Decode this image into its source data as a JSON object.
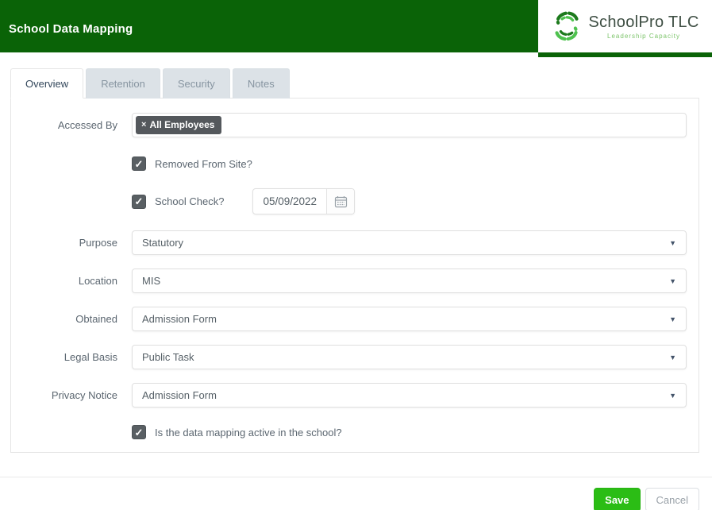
{
  "header": {
    "title": "School Data Mapping",
    "logo": {
      "name": "SchoolPro TLC",
      "tagline": "Leadership Capacity"
    }
  },
  "tabs": [
    {
      "label": "Overview",
      "active": true
    },
    {
      "label": "Retention",
      "active": false
    },
    {
      "label": "Security",
      "active": false
    },
    {
      "label": "Notes",
      "active": false
    }
  ],
  "form": {
    "accessed_by": {
      "label": "Accessed By",
      "tag": "All Employees"
    },
    "removed_from_site": {
      "label": "Removed From Site?",
      "checked": true
    },
    "school_check": {
      "label": "School Check?",
      "checked": true,
      "date": "05/09/2022"
    },
    "purpose": {
      "label": "Purpose",
      "value": "Statutory"
    },
    "location": {
      "label": "Location",
      "value": "MIS"
    },
    "obtained": {
      "label": "Obtained",
      "value": "Admission Form"
    },
    "legal_basis": {
      "label": "Legal Basis",
      "value": "Public Task"
    },
    "privacy_notice": {
      "label": "Privacy Notice",
      "value": "Admission Form"
    },
    "active_mapping": {
      "label": "Is the data mapping active in the school?",
      "checked": true
    }
  },
  "footer": {
    "save_label": "Save",
    "cancel_label": "Cancel"
  },
  "icons": {
    "dropdown_caret": "▼",
    "tag_remove": "×",
    "checkbox_check": "✓",
    "calendar": "calendar-grid"
  },
  "colors": {
    "header_green": "#0a6307",
    "save_green": "#2bbd15",
    "tag_bg": "#54585c",
    "checkbox_bg": "#595f63",
    "active_tab_text": "#33475b",
    "inactive_tab_bg": "#dce2e7"
  }
}
